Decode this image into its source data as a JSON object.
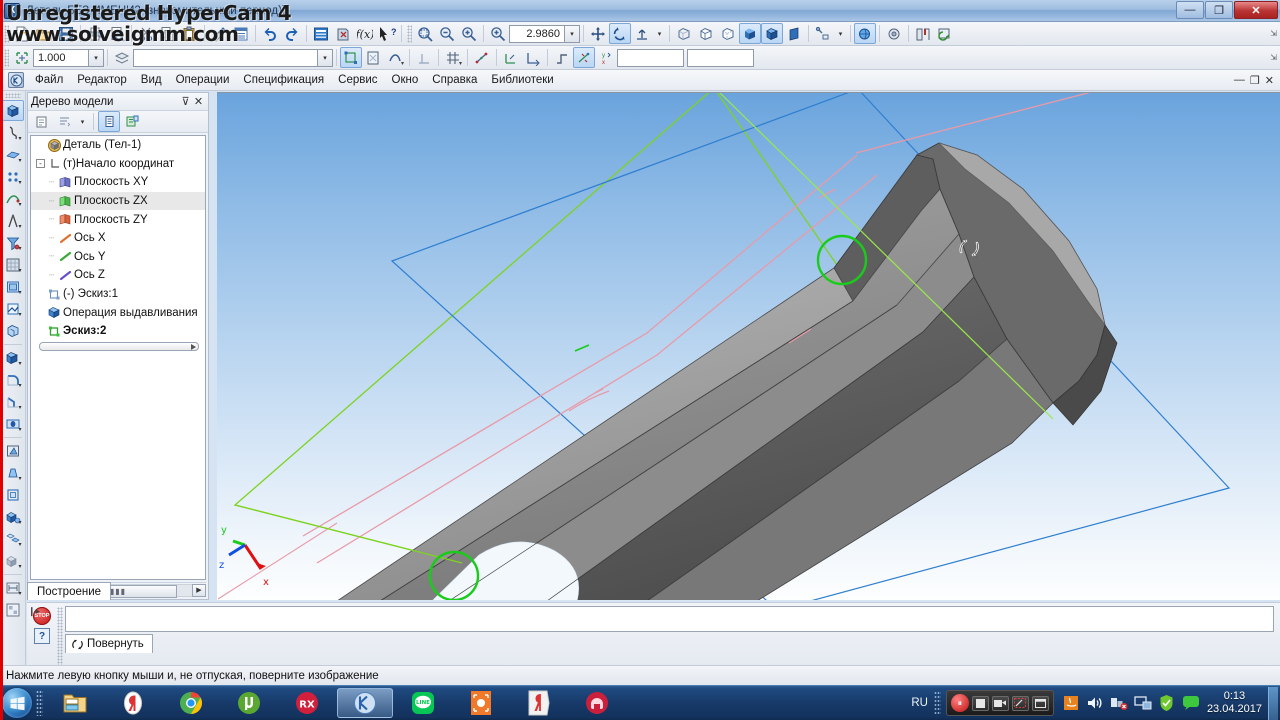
{
  "window": {
    "title": "Деталь БЕЗ ИМЕНИ2 (знакомительный период)]",
    "app_icon": "К",
    "minimize": "—",
    "maximize": "❐",
    "close": "✕"
  },
  "watermark": {
    "line1": "Unregistered HyperCam 4",
    "line2": "www.solveigmm.com"
  },
  "menu": {
    "sys_icon": "kompas-icon",
    "items": [
      {
        "label": "Файл",
        "accel": "Ф"
      },
      {
        "label": "Редактор",
        "accel": "Р"
      },
      {
        "label": "Вид",
        "accel": "В"
      },
      {
        "label": "Операции",
        "accel": "О"
      },
      {
        "label": "Спецификация",
        "accel": "п"
      },
      {
        "label": "Сервис",
        "accel": "е"
      },
      {
        "label": "Окно",
        "accel": "О"
      },
      {
        "label": "Справка",
        "accel": "С"
      },
      {
        "label": "Библиотеки",
        "accel": "Б"
      }
    ],
    "mdi": {
      "minimize": "—",
      "restore": "❐",
      "close": "✕"
    }
  },
  "toolbar_standard": {
    "buttons": [
      {
        "name": "new-document-icon",
        "label": "Создать"
      },
      {
        "name": "open-document-icon",
        "label": "Открыть"
      },
      {
        "name": "save-document-icon",
        "label": "Сохранить"
      },
      {
        "name": "print-icon",
        "label": "Печать"
      },
      {
        "name": "print-preview-icon",
        "label": "Предварительный просмотр"
      },
      {
        "name": "send-mail-icon",
        "label": "Отправить почтой"
      },
      {
        "name": "cut-icon",
        "label": "Вырезать"
      },
      {
        "name": "copy-icon",
        "label": "Копировать"
      },
      {
        "name": "paste-icon",
        "label": "Вставить"
      },
      {
        "name": "format-painter-icon",
        "label": "Копировать свойства"
      },
      {
        "name": "properties-icon",
        "label": "Свойства"
      },
      {
        "name": "undo-icon",
        "label": "Отменить"
      },
      {
        "name": "redo-icon",
        "label": "Повторить"
      },
      {
        "name": "manager-icon",
        "label": "Менеджер документа"
      },
      {
        "name": "rebuild-icon",
        "label": "Перестроить"
      },
      {
        "name": "variables-icon",
        "label": "f(x)"
      },
      {
        "name": "context-help-icon",
        "label": "Контекстная справка"
      }
    ],
    "zoom": {
      "buttons": [
        {
          "name": "zoom-window-icon",
          "label": "Увеличить рамкой"
        },
        {
          "name": "zoom-out-step-icon",
          "label": "Уменьшить масштаб"
        },
        {
          "name": "zoom-in-step-icon",
          "label": "Увеличить масштаб"
        },
        {
          "name": "zoom-scale-icon",
          "label": "Масштаб"
        }
      ],
      "value": "2.9860",
      "dropdown": "▾"
    },
    "nav": [
      {
        "name": "pan-icon",
        "label": "Сдвинуть",
        "active": false
      },
      {
        "name": "rotate-icon",
        "label": "Повернуть",
        "active": true
      },
      {
        "name": "orient-icon",
        "label": "Ориентация",
        "active": false
      }
    ],
    "display": [
      {
        "name": "wireframe-icon",
        "label": "Каркас",
        "active": false
      },
      {
        "name": "hidden-lines-thin-icon",
        "label": "Без невидимых линий",
        "active": false
      },
      {
        "name": "hidden-lines-dashed-icon",
        "label": "Невидимые линии тонкие",
        "active": false
      },
      {
        "name": "shaded-icon",
        "label": "Полутоновое",
        "active": true
      },
      {
        "name": "shaded-edges-icon",
        "label": "Полутоновое с каркасом",
        "active": true
      },
      {
        "name": "perspective-icon",
        "label": "Перспектива",
        "active": false
      },
      {
        "name": "section-icon",
        "label": "Сечение модели",
        "active": false
      },
      {
        "name": "hide-all-icon",
        "label": "Скрыть все объекты",
        "active": true
      },
      {
        "name": "simplify-icon",
        "label": "Упрощённое отображение"
      },
      {
        "name": "settings-icon",
        "label": "Настройка"
      },
      {
        "name": "refresh-icon",
        "label": "Обновить"
      }
    ]
  },
  "toolbar_current_state": {
    "snap_icon": "snap-icon",
    "scale_value": "1.000",
    "scale_dropdown": "▾",
    "layer_icon": "layers-icon",
    "layer_value": "",
    "layer_dropdown": "▾",
    "buttons": [
      {
        "name": "sketch-edit-icon"
      },
      {
        "name": "sketch-mode-icon"
      },
      {
        "name": "curve-icon"
      },
      {
        "name": "perpendicular-icon"
      },
      {
        "name": "grid-icon"
      },
      {
        "name": "snap-points-icon"
      },
      {
        "name": "local-cs-icon"
      },
      {
        "name": "align-icon"
      },
      {
        "name": "step-icon"
      },
      {
        "name": "constraints-icon"
      },
      {
        "name": "coordinates-icon"
      }
    ],
    "x_field": "",
    "y_field": ""
  },
  "vertical_toolbar": {
    "items": [
      {
        "name": "extrusion-icon",
        "label": "Операция выдавливания",
        "active": true
      },
      {
        "name": "rotation-icon",
        "label": "Операция вращения"
      },
      {
        "name": "loft-icon",
        "label": "Кинематическая операция"
      },
      {
        "name": "points-icon",
        "label": "Пространственные кривые"
      },
      {
        "name": "spatial-curve-icon",
        "label": "Пространственная кривая"
      },
      {
        "name": "compass-icon",
        "label": "Вспомогательная геометрия"
      },
      {
        "name": "filter-icon",
        "label": "Фильтры"
      },
      {
        "name": "array-icon",
        "label": "Массив элементов"
      },
      {
        "name": "plane-icon",
        "label": "Смещённая плоскость"
      },
      {
        "name": "sketch-icon",
        "label": "Эскиз"
      },
      {
        "name": "shell-icon",
        "label": "Оболочка"
      },
      {
        "name": "cut-extrude-icon",
        "label": "Вырезать выдавливанием"
      },
      {
        "name": "fillet-icon",
        "label": "Скругление"
      },
      {
        "name": "chamfer-icon",
        "label": "Фаска"
      },
      {
        "name": "hole-icon",
        "label": "Отверстие"
      },
      {
        "name": "rib-icon",
        "label": "Ребро жёсткости"
      },
      {
        "name": "draft-icon",
        "label": "Уклон"
      },
      {
        "name": "thin-wall-icon",
        "label": "Тонкая стенка"
      },
      {
        "name": "boolean-icon",
        "label": "Булева операция"
      },
      {
        "name": "mirror-icon",
        "label": "Зеркальный массив"
      },
      {
        "name": "copy-body-icon",
        "label": "Копия тела"
      },
      {
        "name": "measure-icon",
        "label": "Измерения"
      },
      {
        "name": "mass-icon",
        "label": "МЦХ модели"
      }
    ]
  },
  "tree_panel": {
    "title": "Дерево модели",
    "pin": "⊽",
    "close": "✕",
    "toolbar": [
      {
        "name": "tree-structure-icon",
        "label": "Отображение структуры модели"
      },
      {
        "name": "tree-filter-icon",
        "label": "Фильтр"
      },
      {
        "name": "tree-filter-dropdown",
        "label": "▾"
      },
      {
        "name": "tree-view-list-icon",
        "label": "Дерево построения",
        "active": true
      },
      {
        "name": "tree-view-struct-icon",
        "label": "Структура модели"
      }
    ],
    "nodes": [
      {
        "label": "Деталь (Тел-1)",
        "icon": "part-icon",
        "indent": 0,
        "expander": "",
        "bold": false,
        "selected": false
      },
      {
        "label": "(т)Начало координат",
        "icon": "origin-icon",
        "indent": 1,
        "expander": "-",
        "bold": false,
        "selected": false
      },
      {
        "label": "Плоскость XY",
        "icon": "plane-xy-icon",
        "indent": 2,
        "expander": "",
        "bold": false,
        "selected": false
      },
      {
        "label": "Плоскость ZX",
        "icon": "plane-zx-icon",
        "indent": 2,
        "expander": "",
        "bold": false,
        "selected": true
      },
      {
        "label": "Плоскость ZY",
        "icon": "plane-zy-icon",
        "indent": 2,
        "expander": "",
        "bold": false,
        "selected": false
      },
      {
        "label": "Ось X",
        "icon": "axis-x-icon",
        "indent": 2,
        "expander": "",
        "bold": false,
        "selected": false
      },
      {
        "label": "Ось Y",
        "icon": "axis-y-icon",
        "indent": 2,
        "expander": "",
        "bold": false,
        "selected": false
      },
      {
        "label": "Ось Z",
        "icon": "axis-z-icon",
        "indent": 2,
        "expander": "",
        "bold": false,
        "selected": false
      },
      {
        "label": "(-) Эскиз:1",
        "icon": "sketch-node-icon",
        "indent": 1,
        "expander": "",
        "bold": false,
        "selected": false
      },
      {
        "label": "Операция выдавливания",
        "icon": "extrusion-node-icon",
        "indent": 1,
        "expander": "",
        "bold": false,
        "selected": false
      },
      {
        "label": "Эскиз:2",
        "icon": "sketch-active-icon",
        "indent": 1,
        "expander": "",
        "bold": true,
        "selected": false
      }
    ],
    "hscroll": {
      "left": "◀",
      "right": "▶",
      "thumb": "▮▮▮"
    },
    "build_tab": "Построение"
  },
  "viewport": {
    "zoom_level": "2.9860",
    "cursor": "rotate-cursor",
    "colors": {
      "sky_top": "#6aa4dd",
      "sky_bottom": "#fdfefe",
      "sketch_plane_outline": "#2f7fd0",
      "axis_plane_outline": "#7ed321",
      "sketch_line": "#e89aa8",
      "highlight_circle": "#19cc19",
      "body_light": "#9b9b9b",
      "body_mid": "#7a7a7a",
      "body_dark": "#4e4e4e"
    },
    "axes": [
      {
        "name": "axis-x",
        "label": "x",
        "color": "#e01010"
      },
      {
        "name": "axis-y",
        "label": "y",
        "color": "#19cc19"
      },
      {
        "name": "axis-z",
        "label": "z",
        "color": "#1050e0"
      }
    ]
  },
  "property_bar": {
    "stop_button": "STOP",
    "help_button": "?",
    "input_value": "",
    "tab": {
      "icon": "rotate-icon",
      "label": "Повернуть"
    }
  },
  "status_bar": {
    "hint": "Нажмите левую кнопку мыши и, не отпуская, поверните изображение"
  },
  "taskbar": {
    "start": "start-orb",
    "items": [
      {
        "name": "taskbar-explorer",
        "label": "Проводник",
        "active": false
      },
      {
        "name": "taskbar-yandex-browser",
        "label": "Яндекс.Браузер",
        "active": false
      },
      {
        "name": "taskbar-chrome",
        "label": "Google Chrome",
        "active": false
      },
      {
        "name": "taskbar-utorrent",
        "label": "µTorrent",
        "active": false
      },
      {
        "name": "taskbar-rx",
        "label": "RX",
        "active": false
      },
      {
        "name": "taskbar-kompas",
        "label": "КОМПАС-3D",
        "active": true
      },
      {
        "name": "taskbar-line",
        "label": "LINE",
        "active": false
      },
      {
        "name": "taskbar-orange-app",
        "label": "Приложение",
        "active": false
      },
      {
        "name": "taskbar-yandex",
        "label": "Яндекс",
        "active": false
      },
      {
        "name": "taskbar-audio-app",
        "label": "Аудио",
        "active": false
      }
    ],
    "tray": {
      "language": "RU",
      "hypercam": {
        "record": "⏸",
        "stop": "⏹",
        "buttons": [
          "camera-icon",
          "region-icon",
          "window-icon"
        ]
      },
      "icons": [
        {
          "name": "java-icon"
        },
        {
          "name": "volume-icon"
        },
        {
          "name": "network-error-icon"
        },
        {
          "name": "display-icon"
        },
        {
          "name": "shield-icon"
        },
        {
          "name": "message-icon"
        }
      ],
      "clock": {
        "time": "0:13",
        "date": "23.04.2017"
      }
    }
  }
}
